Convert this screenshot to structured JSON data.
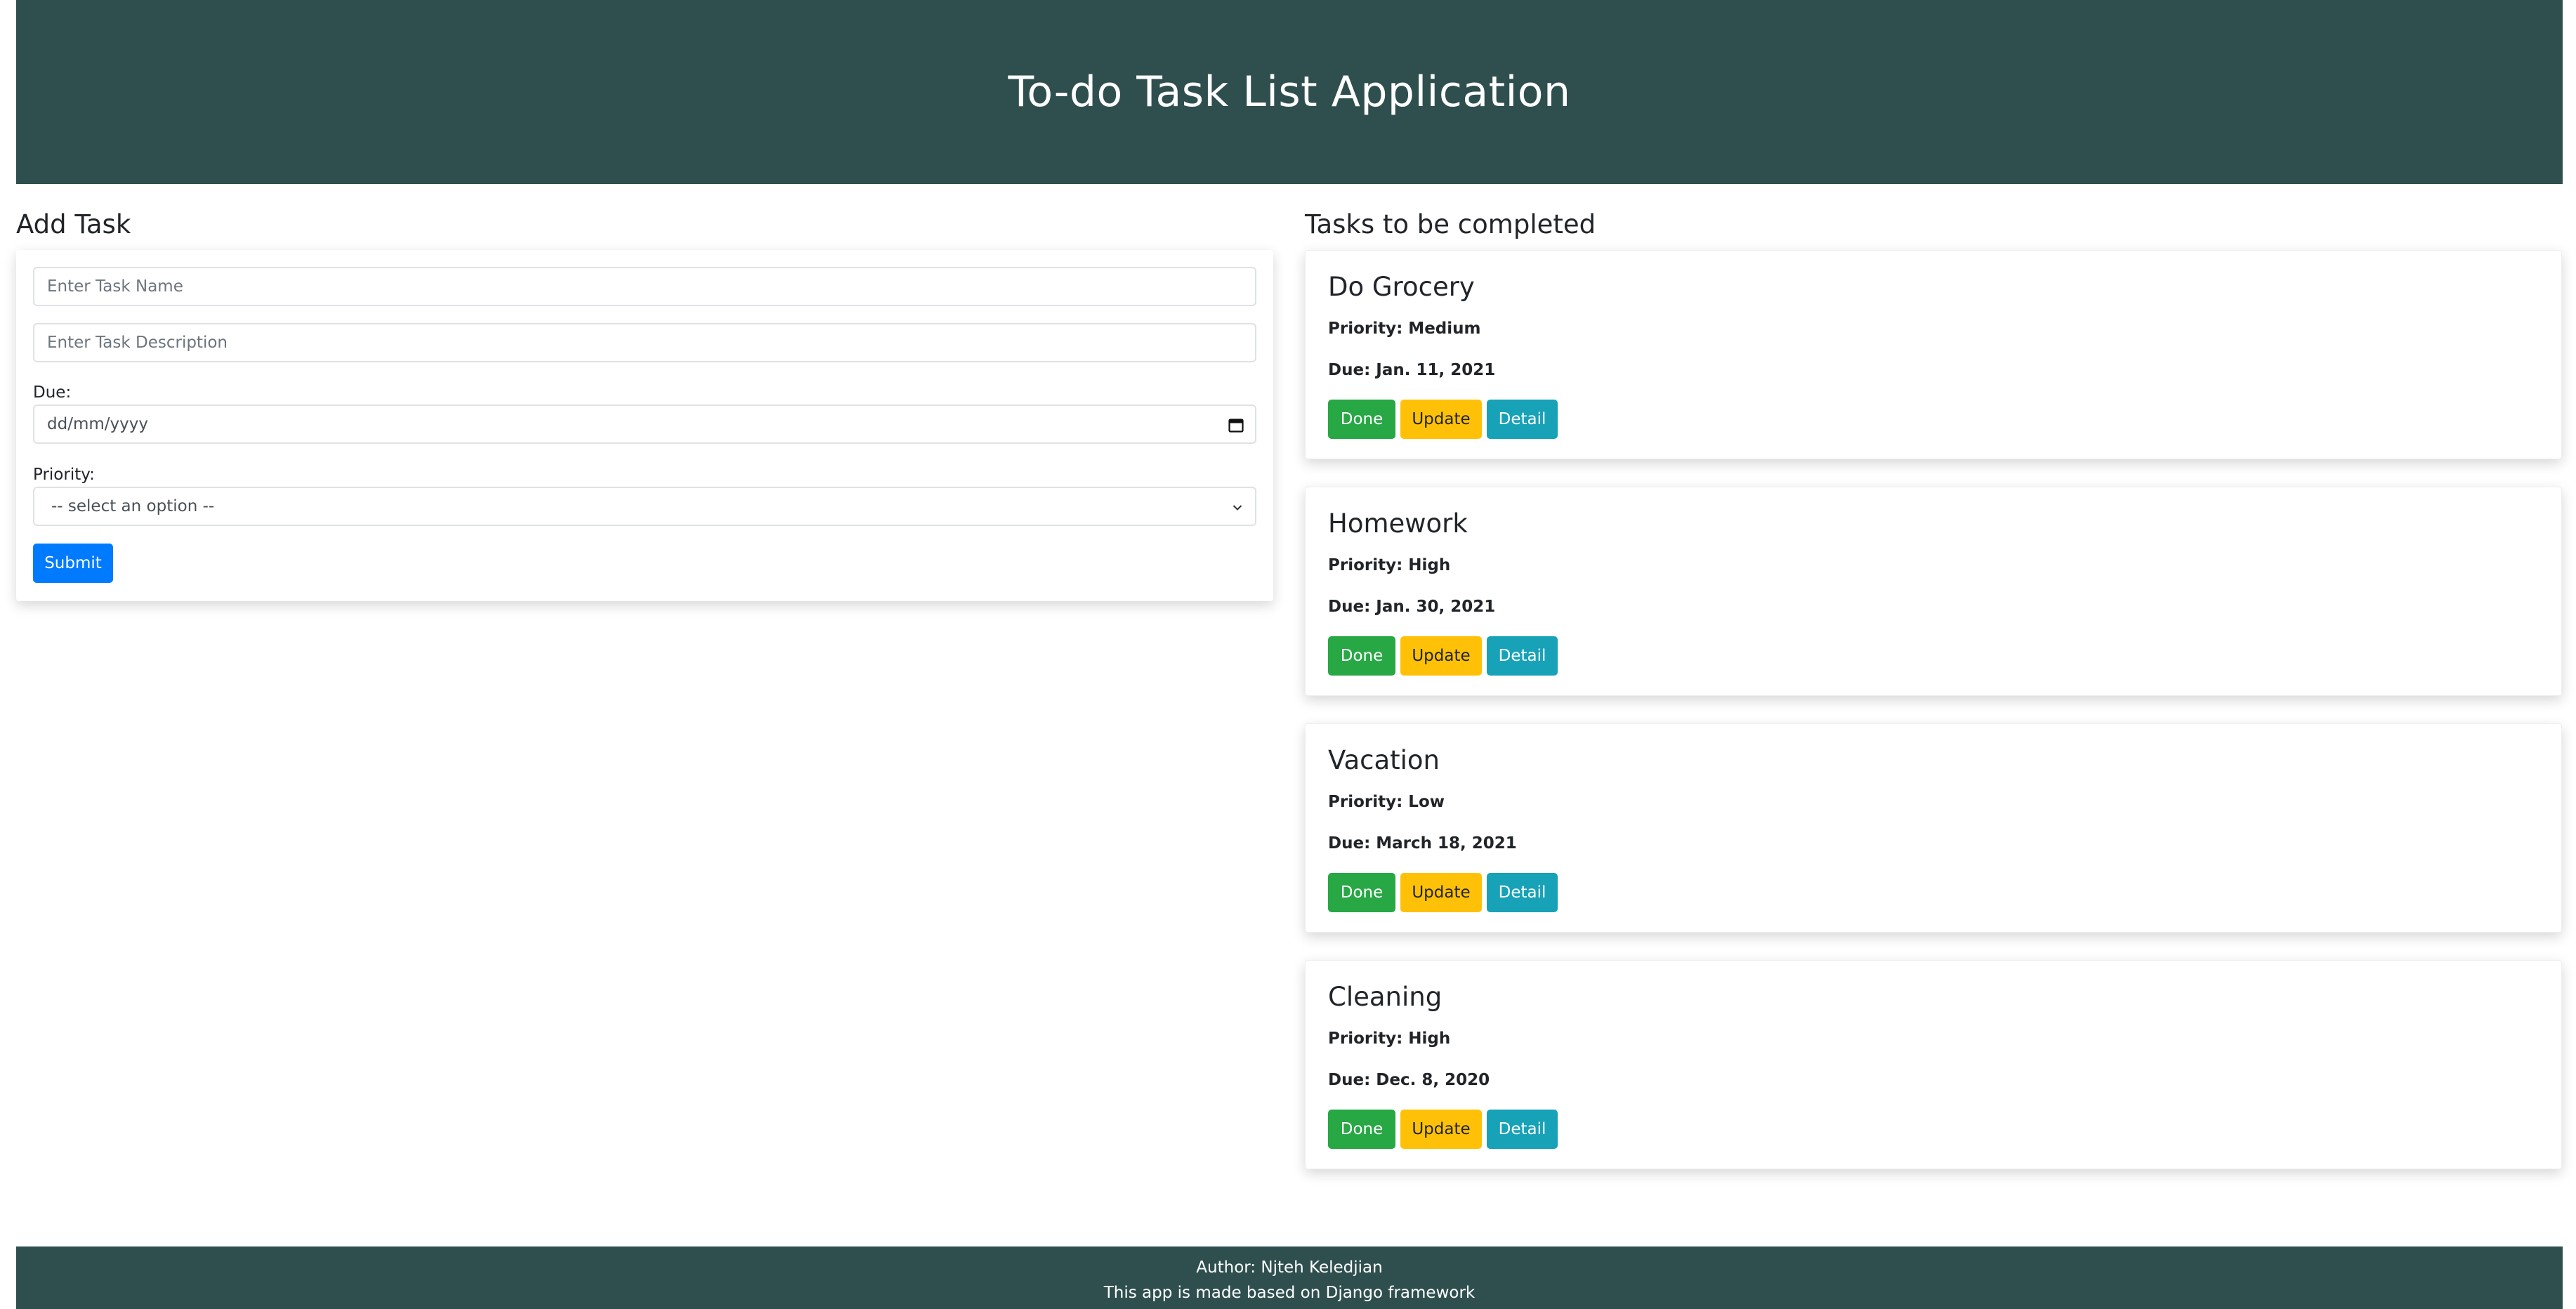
{
  "header": {
    "title": "To-do Task List Application"
  },
  "add_task": {
    "title": "Add Task",
    "name_placeholder": "Enter Task Name",
    "description_placeholder": "Enter Task Description",
    "due_label": "Due:",
    "due_placeholder": "dd/mm/yyyy",
    "priority_label": "Priority:",
    "priority_selected": "-- select an option --",
    "submit_label": "Submit"
  },
  "tasks_section": {
    "title": "Tasks to be completed",
    "tasks": [
      {
        "name": "Do Grocery",
        "priority": "Priority: Medium",
        "due": "Due: Jan. 11, 2021",
        "done_label": "Done",
        "update_label": "Update",
        "detail_label": "Detail"
      },
      {
        "name": "Homework",
        "priority": "Priority: High",
        "due": "Due: Jan. 30, 2021",
        "done_label": "Done",
        "update_label": "Update",
        "detail_label": "Detail"
      },
      {
        "name": "Vacation",
        "priority": "Priority: Low",
        "due": "Due: March 18, 2021",
        "done_label": "Done",
        "update_label": "Update",
        "detail_label": "Detail"
      },
      {
        "name": "Cleaning",
        "priority": "Priority: High",
        "due": "Due: Dec. 8, 2020",
        "done_label": "Done",
        "update_label": "Update",
        "detail_label": "Detail"
      }
    ]
  },
  "footer": {
    "author": "Author: Njteh Keledjian",
    "note": "This app is made based on Django framework"
  },
  "colors": {
    "header_bg": "#2f4f4f",
    "submit": "#007bff",
    "done": "#28a745",
    "update": "#ffc107",
    "detail": "#17a2b8"
  },
  "icons": {
    "date_picker": "calendar-icon",
    "select_arrow": "chevron-down-icon"
  }
}
